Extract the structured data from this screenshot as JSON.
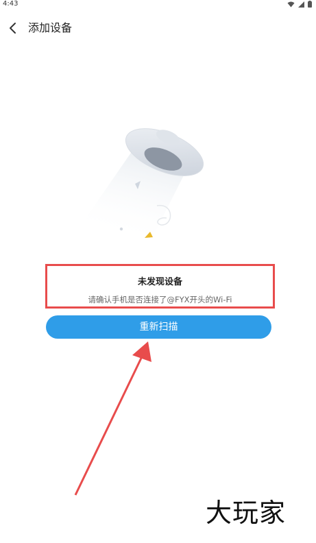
{
  "status_bar": {
    "time": "4:43"
  },
  "header": {
    "title": "添加设备"
  },
  "empty_state": {
    "title": "未发现设备",
    "subtitle": "请确认手机是否连接了@FYX开头的Wi-Fi"
  },
  "actions": {
    "rescan_label": "重新扫描"
  },
  "watermark": {
    "text": "大玩家"
  },
  "colors": {
    "primary_button": "#2f9de8",
    "highlight_border": "#e84c4c",
    "arrow": "#e84c4c"
  }
}
